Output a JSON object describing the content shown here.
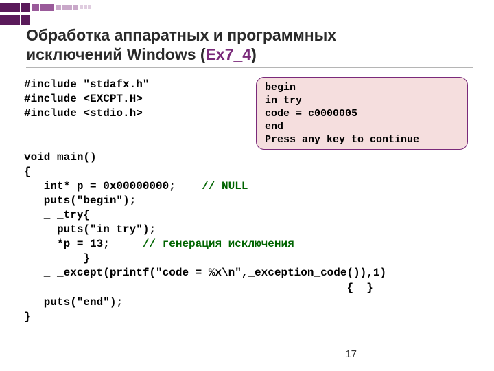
{
  "title": {
    "line1": "Обработка аппаратных и программных",
    "line2_a": "исключений Windows (",
    "line2_accent": "Ex7_4",
    "line2_b": ")"
  },
  "code": {
    "l1": "#include \"stdafx.h\"",
    "l2": "#include <EXCPT.H>",
    "l3": "#include <stdio.h>",
    "l4": "",
    "l5": "",
    "l6": "void main()",
    "l7": "{",
    "l8a": "   int* p = 0x00000000;    ",
    "l8b": "// NULL",
    "l9": "   puts(\"begin\");",
    "l10": "   _ _try{",
    "l11": "     puts(\"in try\");",
    "l12a": "     *p = 13;     ",
    "l12b": "// генерация исключения",
    "l13": "         }",
    "l14": "   _ _except(printf(\"code = %x\\n\",_exception_code()),1)",
    "l15": "                                                 {  }",
    "l16": "   puts(\"end\");",
    "l17": "}"
  },
  "output": "begin\nin try\ncode = c0000005\nend\nPress any key to continue",
  "page": "17",
  "colors": {
    "accent": "#7a2a7a",
    "comment": "#006400",
    "box_bg": "#f5dede"
  }
}
